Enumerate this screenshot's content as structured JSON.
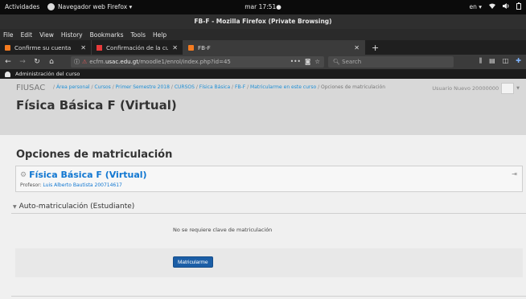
{
  "desktop": {
    "activities": "Actividades",
    "app_name": "Navegador web Firefox ▾",
    "clock": "mar 17:51●",
    "keyboard_layout": "en ▾"
  },
  "window": {
    "title": "FB-F - Mozilla Firefox (Private Browsing)"
  },
  "menu": [
    "File",
    "Edit",
    "View",
    "History",
    "Bookmarks",
    "Tools",
    "Help"
  ],
  "tabs": [
    {
      "title": "Confirme su cuenta",
      "favicon_color": "#f47b20",
      "active": false
    },
    {
      "title": "Confirmación de la cuenta",
      "favicon_color": "#e83a3a",
      "active": false
    },
    {
      "title": "FB-F",
      "favicon_color": "#f47b20",
      "active": true
    }
  ],
  "nav": {
    "url_prefix": "ecfm.",
    "url_domain": "usac.edu.gt",
    "url_path": "/moodle1/enrol/index.php?id=45",
    "search_placeholder": "Search"
  },
  "admin_bar": {
    "label": "Administración del curso"
  },
  "header": {
    "brand": "FIUSAC",
    "breadcrumb": [
      "Área personal",
      "Cursos",
      "Primer Semestre 2018",
      "CURSOS",
      "Física Básica",
      "FB-F",
      "Matricularme en este curso"
    ],
    "breadcrumb_current": "Opciones de matriculación",
    "user_name": "Usuario Nuevo 20000000",
    "page_title": "Física Básica F (Virtual)"
  },
  "main": {
    "section_title": "Opciones de matriculación",
    "course_name": "Física Básica F (Virtual)",
    "teacher_label": "Profesor: ",
    "teacher_name": "Luis Alberto Bautista 200714617",
    "self_enrol_heading": "Auto-matriculación (Estudiante)",
    "no_key_message": "No se requiere clave de matriculación",
    "enrol_button": "Matricularme"
  },
  "colors": {
    "link": "#1177d1",
    "button": "#1b5ea6",
    "header_bg": "#d8d8d8",
    "content_bg": "#f0f0f0"
  }
}
